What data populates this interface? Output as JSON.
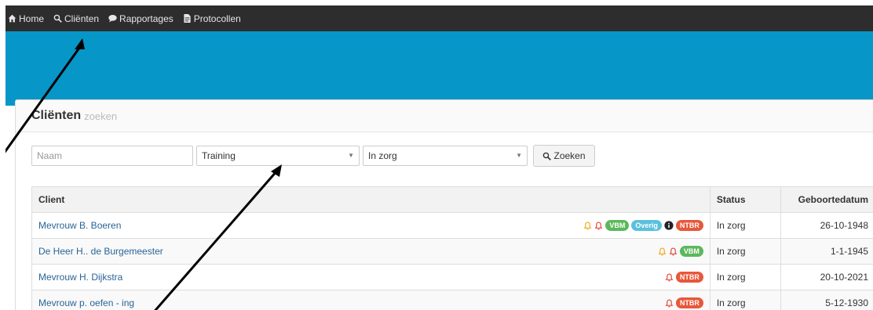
{
  "nav": {
    "items": [
      {
        "label": "Home",
        "icon": "home-icon"
      },
      {
        "label": "Cliënten",
        "icon": "search-icon"
      },
      {
        "label": "Rapportages",
        "icon": "comment-icon"
      },
      {
        "label": "Protocollen",
        "icon": "file-icon"
      }
    ]
  },
  "panel": {
    "title": "Cliënten",
    "subtitle": "zoeken"
  },
  "filters": {
    "name_placeholder": "Naam",
    "training_value": "Training",
    "zorg_value": "In zorg",
    "search_label": "Zoeken"
  },
  "table": {
    "headers": {
      "client": "Client",
      "status": "Status",
      "geb": "Geboortedatum"
    },
    "rows": [
      {
        "name": "Mevrouw B. Boeren",
        "status": "In zorg",
        "geb": "26-10-1948",
        "bells": [
          "orange",
          "red"
        ],
        "badges": [
          {
            "t": "VBM",
            "c": "green"
          },
          {
            "t": "Overig",
            "c": "blue"
          }
        ],
        "info": true,
        "tail": [
          {
            "t": "NTBR",
            "c": "red"
          }
        ]
      },
      {
        "name": "De Heer H.. de Burgemeester",
        "status": "In zorg",
        "geb": "1-1-1945",
        "bells": [
          "orange",
          "red"
        ],
        "badges": [
          {
            "t": "VBM",
            "c": "green"
          }
        ],
        "info": false,
        "tail": []
      },
      {
        "name": "Mevrouw H. Dijkstra",
        "status": "In zorg",
        "geb": "20-10-2021",
        "bells": [
          "red"
        ],
        "badges": [],
        "info": false,
        "tail": [
          {
            "t": "NTBR",
            "c": "red"
          }
        ]
      },
      {
        "name": "Mevrouw p. oefen - ing",
        "status": "In zorg",
        "geb": "5-12-1930",
        "bells": [
          "red"
        ],
        "badges": [],
        "info": false,
        "tail": [
          {
            "t": "NTBR",
            "c": "red"
          }
        ]
      }
    ]
  },
  "colors": {
    "navbar": "#2d2d2d",
    "banner": "#0796c8",
    "link": "#2a6496",
    "bell_orange": "#f0a30a",
    "bell_red": "#e23b2e"
  }
}
